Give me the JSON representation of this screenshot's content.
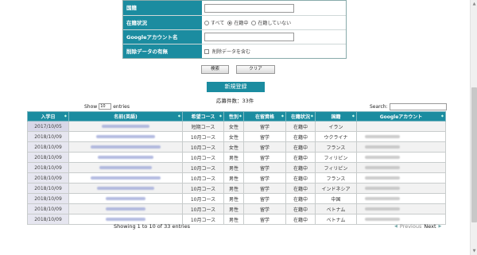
{
  "filter": {
    "rows": [
      {
        "label": "国籍",
        "type": "text"
      },
      {
        "label": "在籍状況",
        "type": "radio",
        "options": [
          "すべて",
          "在籍中",
          "在籍していない"
        ],
        "selected": 1
      },
      {
        "label": "Googleアカウント名",
        "type": "text"
      },
      {
        "label": "削除データの有無",
        "type": "checkbox",
        "option": "削除データを含む"
      }
    ],
    "search_label": "検索",
    "clear_label": "クリア"
  },
  "new_button": "新規登録",
  "count_text": "応募件数：33件",
  "show": {
    "prefix": "Show",
    "value": "10",
    "suffix": "entries"
  },
  "search": {
    "label": "Search:"
  },
  "table": {
    "headers": [
      "入学日",
      "名前(英語)",
      "希望コース",
      "性別",
      "在留資格",
      "在籍状況",
      "国籍",
      "Googleアカウント"
    ],
    "rows": [
      [
        "2017/10/05",
        "",
        "短期コース",
        "女性",
        "留学",
        "在籍中",
        "イラン",
        ""
      ],
      [
        "2018/10/09",
        "",
        "10月コース",
        "女性",
        "留学",
        "在籍中",
        "ウクライナ",
        ""
      ],
      [
        "2018/10/09",
        "",
        "10月コース",
        "女性",
        "留学",
        "在籍中",
        "フランス",
        ""
      ],
      [
        "2018/10/09",
        "",
        "10月コース",
        "男性",
        "留学",
        "在籍中",
        "フィリピン",
        ""
      ],
      [
        "2018/10/09",
        "",
        "10月コース",
        "男性",
        "留学",
        "在籍中",
        "フィリピン",
        ""
      ],
      [
        "2018/10/09",
        "",
        "10月コース",
        "男性",
        "留学",
        "在籍中",
        "フランス",
        ""
      ],
      [
        "2018/10/09",
        "",
        "10月コース",
        "男性",
        "留学",
        "在籍中",
        "インドネシア",
        ""
      ],
      [
        "2018/10/09",
        "",
        "10月コース",
        "男性",
        "留学",
        "在籍中",
        "中国",
        ""
      ],
      [
        "2018/10/09",
        "",
        "10月コース",
        "男性",
        "留学",
        "在籍中",
        "ベトナム",
        ""
      ],
      [
        "2018/10/09",
        "",
        "10月コース",
        "男性",
        "留学",
        "在籍中",
        "ベトナム",
        ""
      ]
    ]
  },
  "info_text": "Showing 1 to 10 of 33 entries",
  "pager": {
    "previous": "Previous",
    "next": "Next"
  },
  "colors": {
    "accent": "#1b8ca0"
  }
}
